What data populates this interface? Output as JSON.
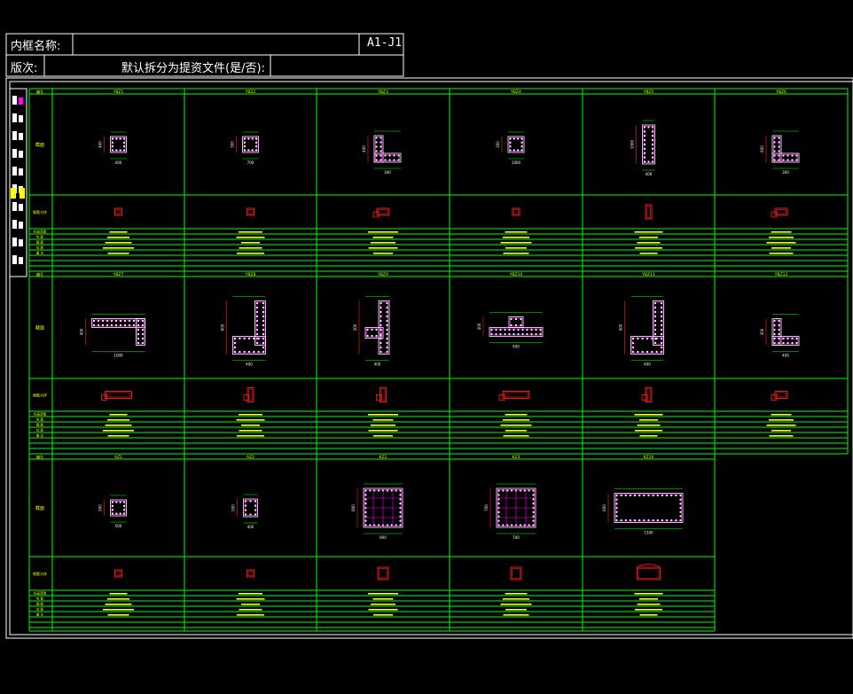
{
  "title_block": {
    "frame_name_label": "内框名称:",
    "drawing_number": "A1-J1",
    "version_label": "版次:",
    "split_question": "默认拆分为提资文件(是/否):"
  },
  "row_headers": [
    "编号",
    "截面",
    "钢筋大样",
    "标高范围",
    "纵 筋",
    "箍 筋",
    "拉 筋",
    "备 注"
  ],
  "groups": [
    {
      "columns": [
        {
          "id": "YBZ1",
          "shape": "rect",
          "dims": [
            "400",
            "400"
          ]
        },
        {
          "id": "YBZ2",
          "shape": "rect",
          "dims": [
            "700",
            "300"
          ]
        },
        {
          "id": "YBZ3",
          "shape": "L",
          "dims": [
            "300",
            "400"
          ]
        },
        {
          "id": "YBZ4",
          "shape": "rect",
          "dims": [
            "1000",
            "300"
          ]
        },
        {
          "id": "YBZ5",
          "shape": "vrect",
          "dims": [
            "400",
            "1000"
          ]
        },
        {
          "id": "YBZ6",
          "shape": "L",
          "dims": [
            "300",
            "600"
          ]
        }
      ]
    },
    {
      "columns": [
        {
          "id": "YBZ7",
          "shape": "Lwide",
          "dims": [
            "1000",
            "400"
          ]
        },
        {
          "id": "YBZ8",
          "shape": "Ltall",
          "dims": [
            "400",
            "600"
          ]
        },
        {
          "id": "YBZ9",
          "shape": "T",
          "dims": [
            "400",
            "300"
          ]
        },
        {
          "id": "YBZ10",
          "shape": "Tflat",
          "dims": [
            "400",
            "400"
          ]
        },
        {
          "id": "YBZ11",
          "shape": "Ltall",
          "dims": [
            "400",
            "400"
          ]
        },
        {
          "id": "YBZ12",
          "shape": "L",
          "dims": [
            "400",
            "300"
          ]
        }
      ]
    },
    {
      "columns": [
        {
          "id": "AZ1",
          "shape": "rect",
          "dims": [
            "500",
            "500"
          ]
        },
        {
          "id": "AZ2",
          "shape": "rectSmall",
          "dims": [
            "400",
            "500"
          ]
        },
        {
          "id": "KZ2",
          "shape": "square",
          "dims": [
            "800",
            "800"
          ]
        },
        {
          "id": "KZ3",
          "shape": "square",
          "dims": [
            "700",
            "700"
          ]
        },
        {
          "id": "KZ10",
          "shape": "special",
          "dims": [
            "1500",
            "600"
          ]
        }
      ]
    }
  ],
  "colors": {
    "grid": "#00ff00",
    "frame": "#ffffff",
    "rebar": "#ff00ff",
    "dim": "#ff2020",
    "text": "#ffff00",
    "title_block": "#ffffff"
  }
}
